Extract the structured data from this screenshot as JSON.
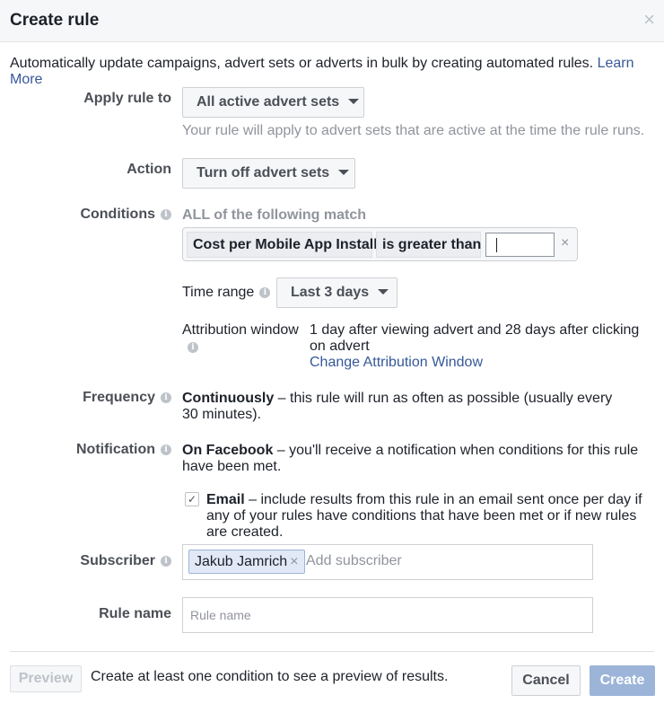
{
  "dialog": {
    "title": "Create rule",
    "close_icon": "×"
  },
  "intro": {
    "text": "Automatically update campaigns, advert sets or adverts in bulk by creating automated rules. ",
    "link": "Learn More"
  },
  "apply_rule": {
    "label": "Apply rule to",
    "value": "All active advert sets",
    "helper": "Your rule will apply to advert sets that are active at the time the rule runs."
  },
  "action": {
    "label": "Action",
    "value": "Turn off advert sets"
  },
  "conditions": {
    "label": "Conditions",
    "match_text": "ALL of the following match",
    "items": [
      {
        "metric": "Cost per Mobile App Install",
        "operator": "is greater than",
        "value": ""
      }
    ],
    "remove_icon": "×"
  },
  "time_range": {
    "label": "Time range",
    "value": "Last 3 days"
  },
  "attribution": {
    "label": "Attribution window",
    "text": "1 day after viewing advert and 28 days after clicking on advert",
    "link": "Change Attribution Window"
  },
  "frequency": {
    "label": "Frequency",
    "bold": "Continuously",
    "text": " – this rule will run as often as possible (usually every 30 minutes)."
  },
  "notification": {
    "label": "Notification",
    "bold": "On Facebook",
    "text": " – you'll receive a notification when conditions for this rule have been met.",
    "email": {
      "checked": true,
      "check_glyph": "✓",
      "bold": "Email",
      "text": " – include results from this rule in an email sent once per day if any of your rules have conditions that have been met or if new rules are created."
    }
  },
  "subscriber": {
    "label": "Subscriber",
    "tokens": [
      "Jakub Jamrich"
    ],
    "token_remove_icon": "×",
    "placeholder": "Add subscriber"
  },
  "rule_name": {
    "label": "Rule name",
    "placeholder": "Rule name",
    "value": ""
  },
  "footer": {
    "preview_label": "Preview",
    "preview_message": "Create at least one condition to see a preview of results.",
    "cancel_label": "Cancel",
    "create_label": "Create"
  },
  "info_icon": "i"
}
